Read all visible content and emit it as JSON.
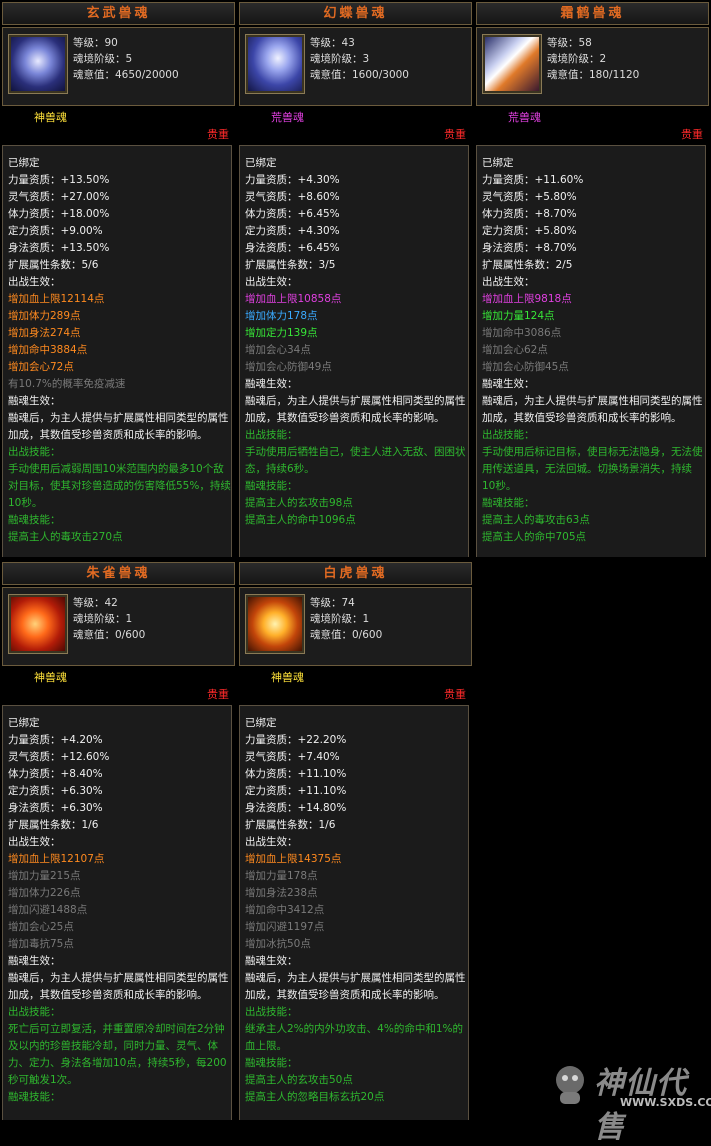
{
  "cards": [
    {
      "title": "玄武兽魂",
      "stats": [
        "等级：90",
        "魂境阶级：5",
        "魂意值：4650/20000"
      ],
      "type": "神兽魂",
      "type_color": "#ffe23a",
      "rarity": "贵重",
      "lines": [
        {
          "t": "已绑定",
          "c": "white"
        },
        {
          "t": "力量资质：+13.50%",
          "c": "white"
        },
        {
          "t": "灵气资质：+27.00%",
          "c": "white"
        },
        {
          "t": "体力资质：+18.00%",
          "c": "white"
        },
        {
          "t": "定力资质：+9.00%",
          "c": "white"
        },
        {
          "t": "身法资质：+13.50%",
          "c": "white"
        },
        {
          "t": "扩展属性条数：5/6",
          "c": "white"
        },
        {
          "t": "出战生效：",
          "c": "white"
        },
        {
          "t": "增加血上限12114点",
          "c": "orange"
        },
        {
          "t": "增加体力289点",
          "c": "orange"
        },
        {
          "t": "增加身法274点",
          "c": "orange"
        },
        {
          "t": "增加命中3884点",
          "c": "orange"
        },
        {
          "t": "增加会心72点",
          "c": "orange"
        },
        {
          "t": "有10.7%的概率免疫减速",
          "c": "gray"
        },
        {
          "t": "融魂生效：",
          "c": "white"
        },
        {
          "t": "融魂后，为主人提供与扩展属性相同类型的属性加成，其数值受珍兽资质和成长率的影响。",
          "c": "white",
          "w": true
        },
        {
          "t": "出战技能：",
          "c": "green"
        },
        {
          "t": "手动使用后减弱周围10米范围内的最多10个敌对目标，使其对珍兽造成的伤害降低55%，持续10秒。",
          "c": "green",
          "w": true
        },
        {
          "t": "融魂技能：",
          "c": "green"
        },
        {
          "t": "提高主人的毒攻击270点",
          "c": "green"
        }
      ]
    },
    {
      "title": "幻蝶兽魂",
      "stats": [
        "等级：43",
        "魂境阶级：3",
        "魂意值：1600/3000"
      ],
      "type": "荒兽魂",
      "type_color": "#e040e0",
      "rarity": "贵重",
      "lines": [
        {
          "t": "已绑定",
          "c": "white"
        },
        {
          "t": "力量资质：+4.30%",
          "c": "white"
        },
        {
          "t": "灵气资质：+8.60%",
          "c": "white"
        },
        {
          "t": "体力资质：+6.45%",
          "c": "white"
        },
        {
          "t": "定力资质：+4.30%",
          "c": "white"
        },
        {
          "t": "身法资质：+6.45%",
          "c": "white"
        },
        {
          "t": "扩展属性条数：3/5",
          "c": "white"
        },
        {
          "t": "出战生效：",
          "c": "white"
        },
        {
          "t": "增加血上限10858点",
          "c": "magenta"
        },
        {
          "t": "增加体力178点",
          "c": "cyan"
        },
        {
          "t": "增加定力139点",
          "c": "lime"
        },
        {
          "t": "增加会心34点",
          "c": "gray"
        },
        {
          "t": "增加会心防御49点",
          "c": "gray"
        },
        {
          "t": "融魂生效：",
          "c": "white"
        },
        {
          "t": "融魂后，为主人提供与扩展属性相同类型的属性加成，其数值受珍兽资质和成长率的影响。",
          "c": "white",
          "w": true
        },
        {
          "t": "出战技能：",
          "c": "green"
        },
        {
          "t": "手动使用后牺牲自己，使主人进入无敌、困困状态，持续6秒。",
          "c": "green",
          "w": true
        },
        {
          "t": "融魂技能：",
          "c": "green"
        },
        {
          "t": "提高主人的玄攻击98点",
          "c": "green"
        },
        {
          "t": "提高主人的命中1096点",
          "c": "green"
        }
      ]
    },
    {
      "title": "霜鹤兽魂",
      "stats": [
        "等级：58",
        "魂境阶级：2",
        "魂意值：180/1120"
      ],
      "type": "荒兽魂",
      "type_color": "#e040e0",
      "rarity": "贵重",
      "lines": [
        {
          "t": "已绑定",
          "c": "white"
        },
        {
          "t": "力量资质：+11.60%",
          "c": "white"
        },
        {
          "t": "灵气资质：+5.80%",
          "c": "white"
        },
        {
          "t": "体力资质：+8.70%",
          "c": "white"
        },
        {
          "t": "定力资质：+5.80%",
          "c": "white"
        },
        {
          "t": "身法资质：+8.70%",
          "c": "white"
        },
        {
          "t": "扩展属性条数：2/5",
          "c": "white"
        },
        {
          "t": "出战生效：",
          "c": "white"
        },
        {
          "t": "增加血上限9818点",
          "c": "magenta"
        },
        {
          "t": "增加力量124点",
          "c": "lime"
        },
        {
          "t": "增加命中3086点",
          "c": "gray"
        },
        {
          "t": "增加会心62点",
          "c": "gray"
        },
        {
          "t": "增加会心防御45点",
          "c": "gray"
        },
        {
          "t": "融魂生效：",
          "c": "white"
        },
        {
          "t": "融魂后，为主人提供与扩展属性相同类型的属性加成，其数值受珍兽资质和成长率的影响。",
          "c": "white",
          "w": true
        },
        {
          "t": "出战技能：",
          "c": "green"
        },
        {
          "t": "手动使用后标记目标，使目标无法隐身，无法使用传送道具，无法回城。切换场景消失，持续10秒。",
          "c": "green",
          "w": true
        },
        {
          "t": "融魂技能：",
          "c": "green"
        },
        {
          "t": "提高主人的毒攻击63点",
          "c": "green"
        },
        {
          "t": "提高主人的命中705点",
          "c": "green"
        }
      ]
    },
    {
      "title": "朱雀兽魂",
      "stats": [
        "等级：42",
        "魂境阶级：1",
        "魂意值：0/600"
      ],
      "type": "神兽魂",
      "type_color": "#ffe23a",
      "rarity": "贵重",
      "lines": [
        {
          "t": "已绑定",
          "c": "white"
        },
        {
          "t": "力量资质：+4.20%",
          "c": "white"
        },
        {
          "t": "灵气资质：+12.60%",
          "c": "white"
        },
        {
          "t": "体力资质：+8.40%",
          "c": "white"
        },
        {
          "t": "定力资质：+6.30%",
          "c": "white"
        },
        {
          "t": "身法资质：+6.30%",
          "c": "white"
        },
        {
          "t": "扩展属性条数：1/6",
          "c": "white"
        },
        {
          "t": "出战生效：",
          "c": "white"
        },
        {
          "t": "增加血上限12107点",
          "c": "orange"
        },
        {
          "t": "增加力量215点",
          "c": "gray"
        },
        {
          "t": "增加体力226点",
          "c": "gray"
        },
        {
          "t": "增加闪避1488点",
          "c": "gray"
        },
        {
          "t": "增加会心25点",
          "c": "gray"
        },
        {
          "t": "增加毒抗75点",
          "c": "gray"
        },
        {
          "t": "融魂生效：",
          "c": "white"
        },
        {
          "t": "融魂后，为主人提供与扩展属性相同类型的属性加成，其数值受珍兽资质和成长率的影响。",
          "c": "white",
          "w": true
        },
        {
          "t": "出战技能：",
          "c": "green"
        },
        {
          "t": "死亡后可立即复活，并重置原冷却时间在2分钟及以内的珍兽技能冷却，同时力量、灵气、体力、定力、身法各增加10点，持续5秒，每200秒可触发1次。",
          "c": "green",
          "w": true
        },
        {
          "t": "融魂技能：",
          "c": "green"
        }
      ]
    },
    {
      "title": "白虎兽魂",
      "stats": [
        "等级：74",
        "魂境阶级：1",
        "魂意值：0/600"
      ],
      "type": "神兽魂",
      "type_color": "#ffe23a",
      "rarity": "贵重",
      "lines": [
        {
          "t": "已绑定",
          "c": "white"
        },
        {
          "t": "力量资质：+22.20%",
          "c": "white"
        },
        {
          "t": "灵气资质：+7.40%",
          "c": "white"
        },
        {
          "t": "体力资质：+11.10%",
          "c": "white"
        },
        {
          "t": "定力资质：+11.10%",
          "c": "white"
        },
        {
          "t": "身法资质：+14.80%",
          "c": "white"
        },
        {
          "t": "扩展属性条数：1/6",
          "c": "white"
        },
        {
          "t": "出战生效：",
          "c": "white"
        },
        {
          "t": "增加血上限14375点",
          "c": "orange"
        },
        {
          "t": "增加力量178点",
          "c": "gray"
        },
        {
          "t": "增加身法238点",
          "c": "gray"
        },
        {
          "t": "增加命中3412点",
          "c": "gray"
        },
        {
          "t": "增加闪避1197点",
          "c": "gray"
        },
        {
          "t": "增加冰抗50点",
          "c": "gray"
        },
        {
          "t": "融魂生效：",
          "c": "white"
        },
        {
          "t": "融魂后，为主人提供与扩展属性相同类型的属性加成，其数值受珍兽资质和成长率的影响。",
          "c": "white",
          "w": true
        },
        {
          "t": "出战技能：",
          "c": "green"
        },
        {
          "t": "继承主人2%的内外功攻击、4%的命中和1%的血上限。",
          "c": "green",
          "w": true
        },
        {
          "t": "融魂技能：",
          "c": "green"
        },
        {
          "t": "提高主人的玄攻击50点",
          "c": "green"
        },
        {
          "t": "提高主人的忽略目标玄抗20点",
          "c": "green"
        }
      ]
    }
  ],
  "watermark": {
    "name": "神仙代售",
    "url": "WWW.SXDS.COM"
  },
  "colors": {
    "title": "#e06a22",
    "rarity": "#ff2a2a",
    "border": "#6b5b3d"
  },
  "icons": [
    "tortoise-portrait-icon",
    "butterfly-portrait-icon",
    "crane-portrait-icon",
    "vermilion-bird-portrait-icon",
    "white-tiger-portrait-icon",
    "mascot-icon"
  ]
}
